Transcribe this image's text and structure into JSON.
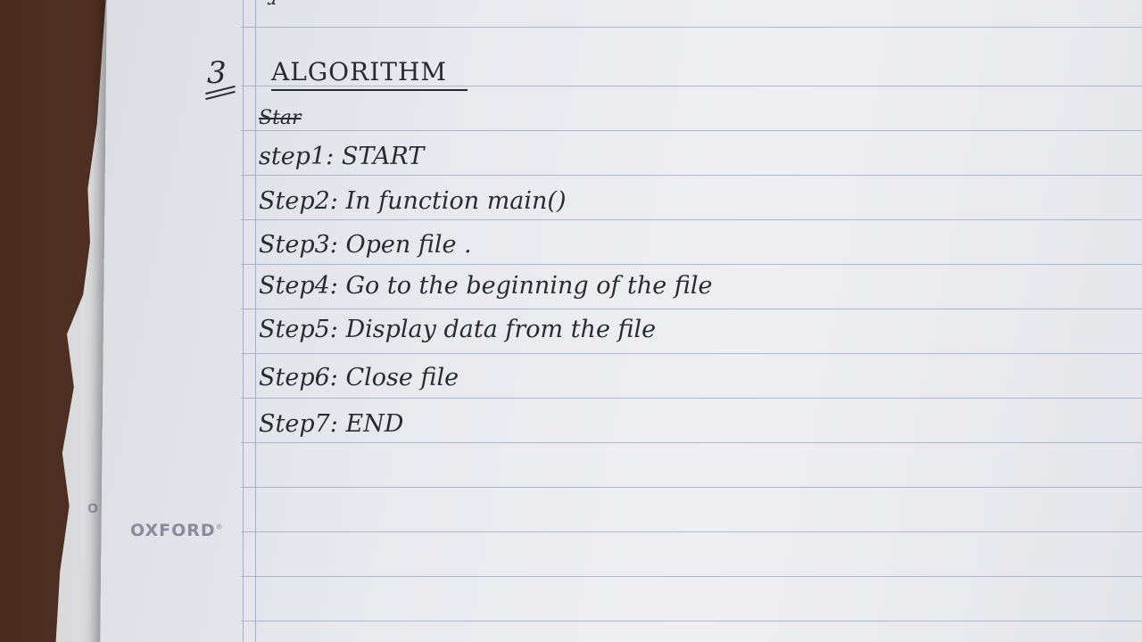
{
  "notebook": {
    "brand": "OXFORD",
    "brand_mark": "®",
    "brand_partial": "O"
  },
  "note": {
    "section_number": "3",
    "heading": "ALGORITHM",
    "struck_word": "Star",
    "steps": [
      "step1: START",
      "Step2: In function main()",
      "Step3: Open file .",
      "Step4: Go to the beginning of the file",
      "Step5: Display data from the file",
      "Step6: Close file",
      "Step7: END"
    ]
  }
}
